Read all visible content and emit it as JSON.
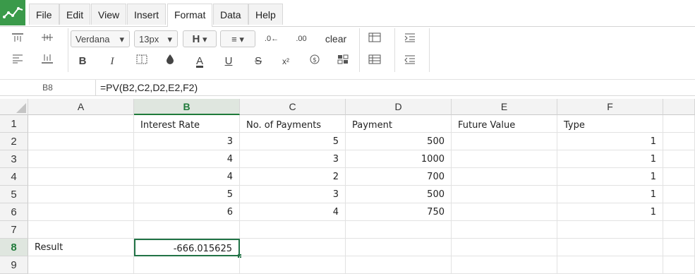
{
  "menu": {
    "items": [
      "File",
      "Edit",
      "View",
      "Insert",
      "Format",
      "Data",
      "Help"
    ],
    "active": "Format"
  },
  "toolbar": {
    "font_family": "Verdana",
    "font_size": "13px",
    "clear_label": "clear",
    "icons": [
      "align-top-icon",
      "align-middle-icon",
      "align-left-icon",
      "align-center-icon",
      "bold-icon",
      "italic-icon",
      "border-icon",
      "fill-color-icon",
      "font-color-icon",
      "underline-icon",
      "strikethrough-icon",
      "superscript-icon",
      "currency-icon",
      "format-icon",
      "decrease-decimal-icon",
      "increase-decimal-icon",
      "table-icon",
      "grid-icon",
      "indent-icon",
      "outdent-icon"
    ],
    "bold": "B",
    "italic": "I",
    "font_color": "A",
    "underline": "U",
    "strike": "S",
    "superscript": "x²",
    "decimal_decrease": ".0",
    "decimal_increase": ".00"
  },
  "formula_bar": {
    "cell_ref": "B8",
    "formula": "=PV(B2,C2,D2,E2,F2)"
  },
  "sheet": {
    "columns": [
      "A",
      "B",
      "C",
      "D",
      "E",
      "F"
    ],
    "selected_column": "B",
    "selected_row": "8",
    "rows": [
      {
        "num": "1",
        "cells": [
          "",
          "Interest Rate",
          "No. of Payments",
          "Payment",
          "Future Value",
          "Type"
        ]
      },
      {
        "num": "2",
        "cells": [
          "",
          "3",
          "5",
          "500",
          "",
          "1"
        ]
      },
      {
        "num": "3",
        "cells": [
          "",
          "4",
          "3",
          "1000",
          "",
          "1"
        ]
      },
      {
        "num": "4",
        "cells": [
          "",
          "4",
          "2",
          "700",
          "",
          "1"
        ]
      },
      {
        "num": "5",
        "cells": [
          "",
          "5",
          "3",
          "500",
          "",
          "1"
        ]
      },
      {
        "num": "6",
        "cells": [
          "",
          "6",
          "4",
          "750",
          "",
          "1"
        ]
      },
      {
        "num": "7",
        "cells": [
          "",
          "",
          "",
          "",
          "",
          ""
        ]
      },
      {
        "num": "8",
        "cells": [
          "Result",
          "-666.015625",
          "",
          "",
          "",
          ""
        ]
      },
      {
        "num": "9",
        "cells": [
          "",
          "",
          "",
          "",
          "",
          ""
        ]
      }
    ]
  },
  "colors": {
    "accent": "#217346",
    "logo": "#3a9a4a"
  }
}
